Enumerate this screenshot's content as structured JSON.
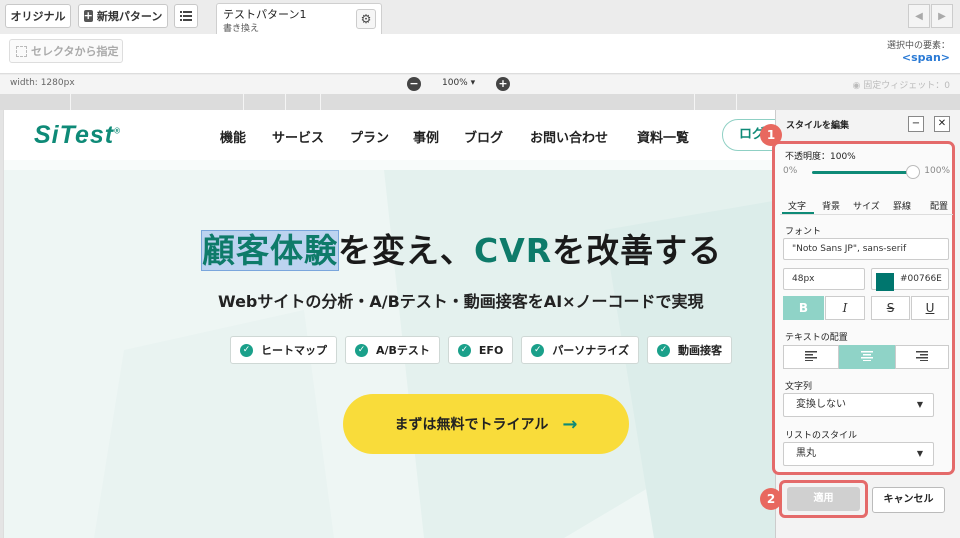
{
  "toolbar": {
    "original_label": "オリジナル",
    "new_pattern_label": "新規パターン",
    "list_icon": "list-icon",
    "pattern_tab": {
      "name": "テストパターン1",
      "mode": "書き換え"
    },
    "prev_icon": "chevron-left-icon",
    "next_icon": "chevron-right-icon"
  },
  "selector": {
    "button_label": "セレクタから指定",
    "selected_label": "選択中の要素：",
    "selected_value": "<span>"
  },
  "zoom": {
    "width_label": "width: 1280px",
    "zoom_out": "−",
    "zoom_value": "100% ▾",
    "zoom_in": "+",
    "fixed_widget": "◉ 固定ウィジェット：0"
  },
  "site": {
    "logo": "SiTest",
    "logo_reg": "®",
    "nav": [
      "機能",
      "サービス",
      "プラン",
      "事例",
      "ブログ",
      "お問い合わせ",
      "資料一覧"
    ],
    "login": "ログ",
    "hero": {
      "title_highlight": "顧客体験",
      "title_rest_1": "を変え、",
      "title_cvr": "CVR",
      "title_rest_2": "を改善する",
      "subtitle": "Webサイトの分析・A/Bテスト・動画接客をAI×ノーコードで実現",
      "features": [
        "ヒートマップ",
        "A/Bテスト",
        "EFO",
        "パーソナライズ",
        "動画接客"
      ],
      "cta": "まずは無料でトライアル",
      "cta_arrow": "→"
    }
  },
  "panel": {
    "title": "スタイルを編集",
    "minimize": "−",
    "close": "✕",
    "badge1": "1",
    "badge2": "2",
    "opacity_label": "不透明度：100%",
    "opacity_min": "0%",
    "opacity_max": "100%",
    "opacity_value": 1.0,
    "tabs": [
      "文字",
      "背景",
      "サイズ",
      "罫線",
      "配置"
    ],
    "font_label": "フォント",
    "font_value": "\"Noto Sans JP\", sans-serif",
    "font_size": "48px",
    "color_value": "#00766E",
    "color_swatch": "#00766e",
    "format_buttons": [
      "B",
      "I",
      "S",
      "U"
    ],
    "align_label": "テキストの配置",
    "align_icons": [
      "align-left-icon",
      "align-center-icon",
      "align-right-icon"
    ],
    "text_transform_label": "文字列",
    "text_transform_value": "変換しない",
    "list_style_label": "リストのスタイル",
    "list_style_value": "黒丸",
    "apply": "適用",
    "cancel": "キャンセル"
  },
  "colors": {
    "accent": "#0e8a77",
    "highlight_box": "#e46a6a",
    "cta": "#f9dc3a"
  }
}
